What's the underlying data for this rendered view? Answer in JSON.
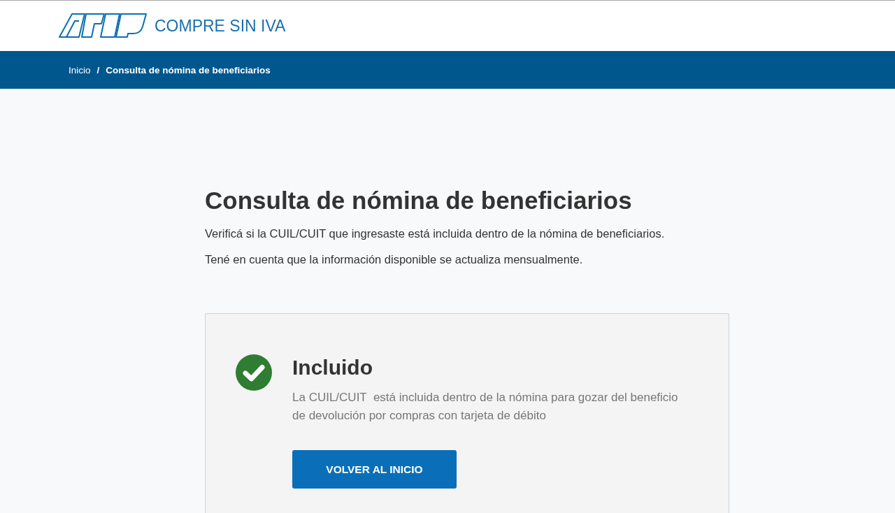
{
  "header": {
    "title": "COMPRE SIN IVA"
  },
  "breadcrumb": {
    "separator": "/",
    "items": [
      {
        "label": "Inicio",
        "current": false
      },
      {
        "label": "Consulta de nómina de beneficiarios",
        "current": true
      }
    ]
  },
  "page": {
    "title": "Consulta de nómina de beneficiarios",
    "paragraphs": [
      "Verificá si la CUIL/CUIT que ingresaste está incluida dentro de la nómina de beneficiarios.",
      "Tené en cuenta que la información disponible se actualiza mensualmente."
    ]
  },
  "result": {
    "kind": "success",
    "title": "Incluido",
    "message": "La CUIL/CUIT  está incluida dentro de la nómina para gozar del beneficio de devolución por compras con tarjeta de débito",
    "button": "VOLVER AL INICIO"
  }
}
